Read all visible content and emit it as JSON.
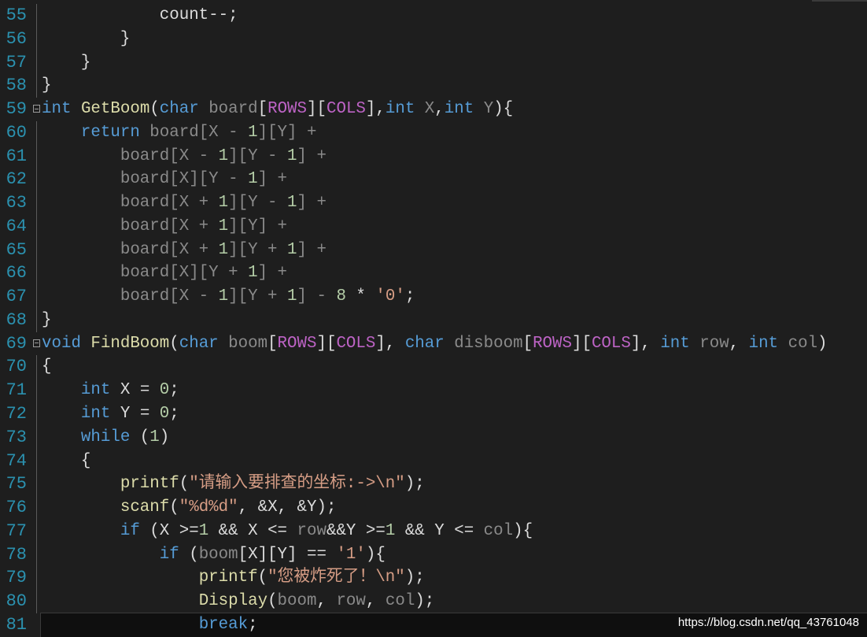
{
  "colors": {
    "background": "#1e1e1e",
    "line_number": "#2b91af",
    "keyword": "#569cd6",
    "function": "#dcdcaa",
    "parameter": "#8a8a8a",
    "macro": "#bd63c5",
    "string": "#d69d85",
    "number": "#b5cea8"
  },
  "current_line": 81,
  "watermark": "https://blog.csdn.net/qq_43761048",
  "lines": [
    {
      "num": "55",
      "tokens": [
        [
          "            count--;",
          "t"
        ]
      ]
    },
    {
      "num": "56",
      "tokens": [
        [
          "        }",
          "t"
        ]
      ]
    },
    {
      "num": "57",
      "tokens": [
        [
          "    }",
          "t"
        ]
      ]
    },
    {
      "num": "58",
      "tokens": [
        [
          "}",
          "t"
        ]
      ]
    },
    {
      "num": "59",
      "fold": true,
      "tokens": [
        [
          "int",
          "k"
        ],
        [
          " ",
          "t"
        ],
        [
          "GetBoom",
          "f"
        ],
        [
          "(",
          "t"
        ],
        [
          "char",
          "k"
        ],
        [
          " board",
          "p"
        ],
        [
          "[",
          "t"
        ],
        [
          "ROWS",
          "m"
        ],
        [
          "][",
          "t"
        ],
        [
          "COLS",
          "m"
        ],
        [
          "],",
          "t"
        ],
        [
          "int",
          "k"
        ],
        [
          " X",
          "p"
        ],
        [
          ",",
          "t"
        ],
        [
          "int",
          "k"
        ],
        [
          " Y",
          "p"
        ],
        [
          "){",
          "t"
        ]
      ]
    },
    {
      "num": "60",
      "tokens": [
        [
          "    ",
          "t"
        ],
        [
          "return",
          "k"
        ],
        [
          " board[X - ",
          "p"
        ],
        [
          "1",
          "n"
        ],
        [
          "][Y] +",
          "p"
        ]
      ]
    },
    {
      "num": "61",
      "tokens": [
        [
          "        board[X - ",
          "p"
        ],
        [
          "1",
          "n"
        ],
        [
          "][Y - ",
          "p"
        ],
        [
          "1",
          "n"
        ],
        [
          "] +",
          "p"
        ]
      ]
    },
    {
      "num": "62",
      "tokens": [
        [
          "        board[X][Y - ",
          "p"
        ],
        [
          "1",
          "n"
        ],
        [
          "] +",
          "p"
        ]
      ]
    },
    {
      "num": "63",
      "tokens": [
        [
          "        board[X + ",
          "p"
        ],
        [
          "1",
          "n"
        ],
        [
          "][Y - ",
          "p"
        ],
        [
          "1",
          "n"
        ],
        [
          "] +",
          "p"
        ]
      ]
    },
    {
      "num": "64",
      "tokens": [
        [
          "        board[X + ",
          "p"
        ],
        [
          "1",
          "n"
        ],
        [
          "][Y] +",
          "p"
        ]
      ]
    },
    {
      "num": "65",
      "tokens": [
        [
          "        board[X + ",
          "p"
        ],
        [
          "1",
          "n"
        ],
        [
          "][Y + ",
          "p"
        ],
        [
          "1",
          "n"
        ],
        [
          "] +",
          "p"
        ]
      ]
    },
    {
      "num": "66",
      "tokens": [
        [
          "        board[X][Y + ",
          "p"
        ],
        [
          "1",
          "n"
        ],
        [
          "] +",
          "p"
        ]
      ]
    },
    {
      "num": "67",
      "tokens": [
        [
          "        board[X - ",
          "p"
        ],
        [
          "1",
          "n"
        ],
        [
          "][Y + ",
          "p"
        ],
        [
          "1",
          "n"
        ],
        [
          "] - ",
          "p"
        ],
        [
          "8",
          "n"
        ],
        [
          " * ",
          "t"
        ],
        [
          "'0'",
          "s"
        ],
        [
          ";",
          "t"
        ]
      ]
    },
    {
      "num": "68",
      "tokens": [
        [
          "}",
          "t"
        ]
      ]
    },
    {
      "num": "69",
      "fold": true,
      "tokens": [
        [
          "void",
          "k"
        ],
        [
          " ",
          "t"
        ],
        [
          "FindBoom",
          "f"
        ],
        [
          "(",
          "t"
        ],
        [
          "char",
          "k"
        ],
        [
          " boom",
          "p"
        ],
        [
          "[",
          "t"
        ],
        [
          "ROWS",
          "m"
        ],
        [
          "][",
          "t"
        ],
        [
          "COLS",
          "m"
        ],
        [
          "], ",
          "t"
        ],
        [
          "char",
          "k"
        ],
        [
          " disboom",
          "p"
        ],
        [
          "[",
          "t"
        ],
        [
          "ROWS",
          "m"
        ],
        [
          "][",
          "t"
        ],
        [
          "COLS",
          "m"
        ],
        [
          "], ",
          "t"
        ],
        [
          "int",
          "k"
        ],
        [
          " row",
          "p"
        ],
        [
          ", ",
          "t"
        ],
        [
          "int",
          "k"
        ],
        [
          " col",
          "p"
        ],
        [
          ")",
          "t"
        ]
      ]
    },
    {
      "num": "70",
      "tokens": [
        [
          "{",
          "t"
        ]
      ]
    },
    {
      "num": "71",
      "tokens": [
        [
          "    ",
          "t"
        ],
        [
          "int",
          "k"
        ],
        [
          " X = ",
          "t"
        ],
        [
          "0",
          "n"
        ],
        [
          ";",
          "t"
        ]
      ]
    },
    {
      "num": "72",
      "tokens": [
        [
          "    ",
          "t"
        ],
        [
          "int",
          "k"
        ],
        [
          " Y = ",
          "t"
        ],
        [
          "0",
          "n"
        ],
        [
          ";",
          "t"
        ]
      ]
    },
    {
      "num": "73",
      "tokens": [
        [
          "    ",
          "t"
        ],
        [
          "while",
          "k"
        ],
        [
          " (",
          "t"
        ],
        [
          "1",
          "n"
        ],
        [
          ")",
          "t"
        ]
      ]
    },
    {
      "num": "74",
      "tokens": [
        [
          "    {",
          "t"
        ]
      ]
    },
    {
      "num": "75",
      "tokens": [
        [
          "        ",
          "t"
        ],
        [
          "printf",
          "f"
        ],
        [
          "(",
          "t"
        ],
        [
          "\"请输入要排查的坐标:->\\n\"",
          "s"
        ],
        [
          ");",
          "t"
        ]
      ]
    },
    {
      "num": "76",
      "tokens": [
        [
          "        ",
          "t"
        ],
        [
          "scanf",
          "f"
        ],
        [
          "(",
          "t"
        ],
        [
          "\"%d%d\"",
          "s"
        ],
        [
          ", &X, &Y);",
          "t"
        ]
      ]
    },
    {
      "num": "77",
      "tokens": [
        [
          "        ",
          "t"
        ],
        [
          "if",
          "k"
        ],
        [
          " (X >=",
          "t"
        ],
        [
          "1",
          "n"
        ],
        [
          " && X <= ",
          "t"
        ],
        [
          "row",
          "p"
        ],
        [
          "&&Y >=",
          "t"
        ],
        [
          "1",
          "n"
        ],
        [
          " && Y <= ",
          "t"
        ],
        [
          "col",
          "p"
        ],
        [
          "){",
          "t"
        ]
      ]
    },
    {
      "num": "78",
      "tokens": [
        [
          "            ",
          "t"
        ],
        [
          "if",
          "k"
        ],
        [
          " (",
          "t"
        ],
        [
          "boom",
          "p"
        ],
        [
          "[X][Y] == ",
          "t"
        ],
        [
          "'1'",
          "s"
        ],
        [
          "){",
          "t"
        ]
      ]
    },
    {
      "num": "79",
      "tokens": [
        [
          "                ",
          "t"
        ],
        [
          "printf",
          "f"
        ],
        [
          "(",
          "t"
        ],
        [
          "\"您被炸死了！\\n\"",
          "s"
        ],
        [
          ");",
          "t"
        ]
      ]
    },
    {
      "num": "80",
      "tokens": [
        [
          "                ",
          "t"
        ],
        [
          "Display",
          "f"
        ],
        [
          "(",
          "t"
        ],
        [
          "boom",
          "p"
        ],
        [
          ", ",
          "t"
        ],
        [
          "row",
          "p"
        ],
        [
          ", ",
          "t"
        ],
        [
          "col",
          "p"
        ],
        [
          ");",
          "t"
        ]
      ]
    },
    {
      "num": "81",
      "tokens": [
        [
          "                ",
          "t"
        ],
        [
          "break",
          "k"
        ],
        [
          ";",
          "t"
        ]
      ]
    }
  ]
}
